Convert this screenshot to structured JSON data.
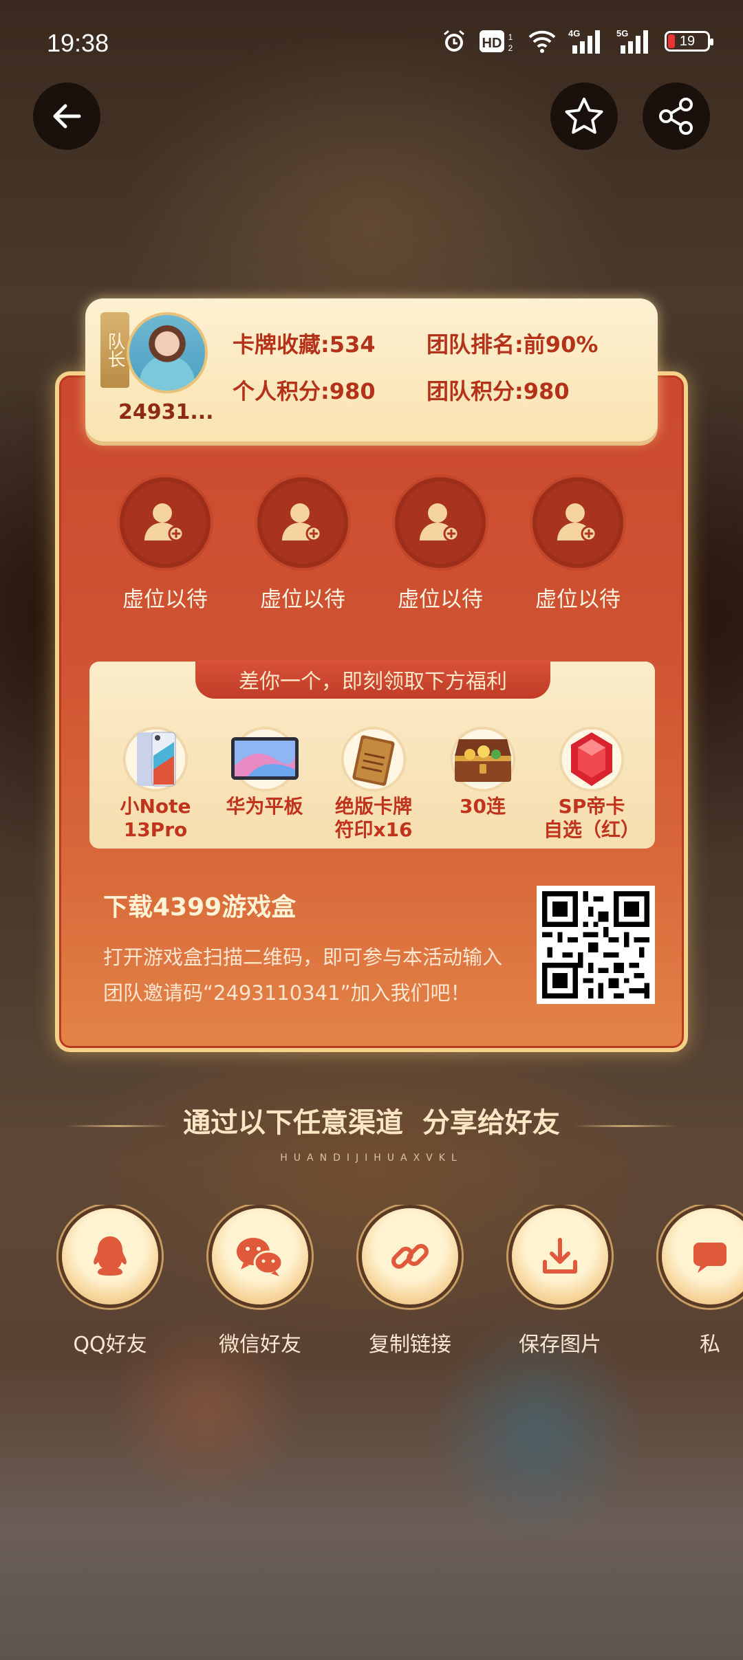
{
  "status_bar": {
    "time": "19:38",
    "battery": "19",
    "icons": [
      "alarm-icon",
      "hd-icon",
      "wifi-icon",
      "4g-signal-icon",
      "5g-signal-icon",
      "battery-icon"
    ]
  },
  "nav": {
    "back_icon": "arrow-left-icon",
    "favorite_icon": "star-icon",
    "share_icon": "share-icon"
  },
  "team_card": {
    "captain_badge": "队长",
    "captain_id": "24931...",
    "stats": {
      "card_collection": "卡牌收藏:534",
      "team_rank": "团队排名:前90%",
      "personal_points": "个人积分:980",
      "team_points": "团队积分:980"
    },
    "slots": [
      {
        "label": "虚位以待"
      },
      {
        "label": "虚位以待"
      },
      {
        "label": "虚位以待"
      },
      {
        "label": "虚位以待"
      }
    ],
    "rewards_banner": "差你一个，即刻领取下方福利",
    "rewards": [
      {
        "label": "小Note\n13Pro"
      },
      {
        "label": "华为平板"
      },
      {
        "label": "绝版卡牌\n符印x16"
      },
      {
        "label": "30连"
      },
      {
        "label": "SP帝卡\n自选（红）"
      }
    ],
    "download_title": "下载4399游戏盒",
    "download_desc": "打开游戏盒扫描二维码，即可参与本活动输入团队邀请码“2493110341”加入我们吧！"
  },
  "share": {
    "title": "通过以下任意渠道  分享给好友",
    "subtitle": "HUANDIJIHUAXVKL",
    "channels": [
      {
        "label": "QQ好友",
        "icon": "qq-icon"
      },
      {
        "label": "微信好友",
        "icon": "wechat-icon"
      },
      {
        "label": "复制链接",
        "icon": "link-icon"
      },
      {
        "label": "保存图片",
        "icon": "download-icon"
      },
      {
        "label": "私",
        "icon": "chat-icon"
      }
    ]
  },
  "colors": {
    "card_red": "#cc4a2f",
    "card_border": "#f5d18a",
    "header_cream": "#fdf1d2",
    "stat_text": "#b5321a"
  }
}
